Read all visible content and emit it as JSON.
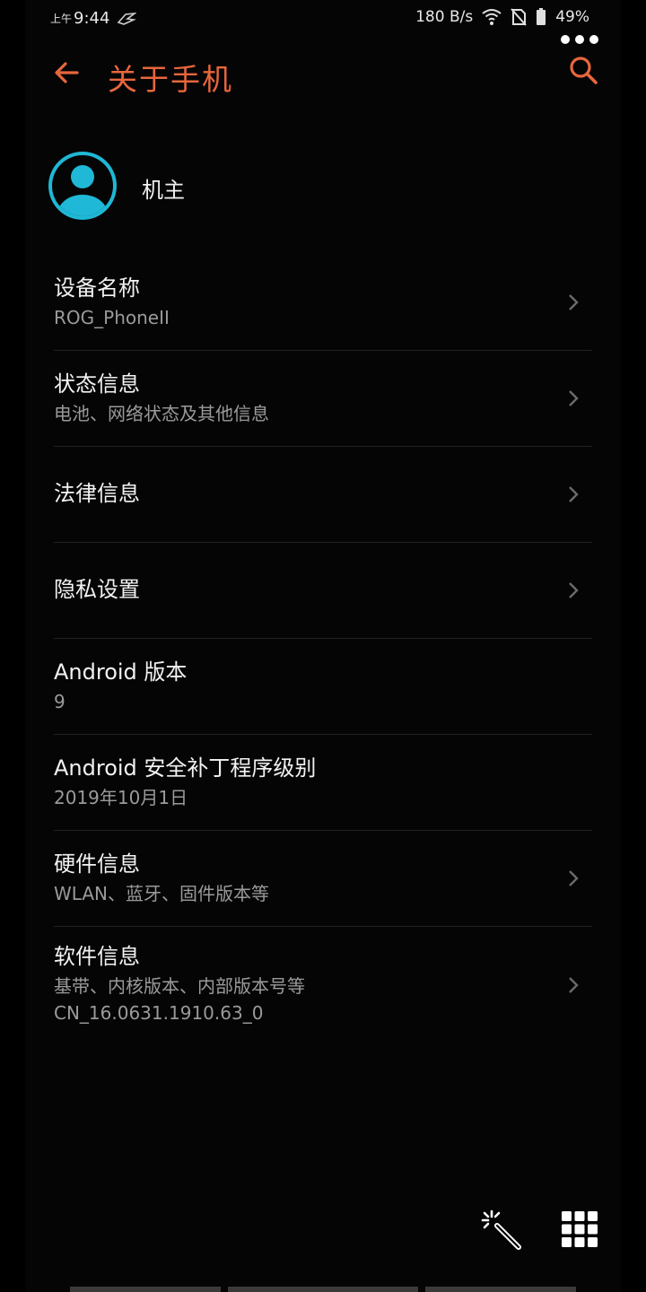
{
  "status_bar": {
    "ampm": "上午",
    "time": "9:44",
    "net_speed": "180 B/s",
    "battery": "49%"
  },
  "header": {
    "title": "关于手机"
  },
  "owner": {
    "name": "机主"
  },
  "items": [
    {
      "title": "设备名称",
      "subtitle": "ROG_PhoneII",
      "has_chevron": true
    },
    {
      "title": "状态信息",
      "subtitle": "电池、网络状态及其他信息",
      "has_chevron": true
    },
    {
      "title": "法律信息",
      "subtitle": "",
      "has_chevron": true
    },
    {
      "title": "隐私设置",
      "subtitle": "",
      "has_chevron": true
    },
    {
      "title": "Android 版本",
      "subtitle": "9",
      "has_chevron": false
    },
    {
      "title": "Android 安全补丁程序级别",
      "subtitle": "2019年10月1日",
      "has_chevron": false
    },
    {
      "title": "硬件信息",
      "subtitle": "WLAN、蓝牙、固件版本等",
      "has_chevron": true
    },
    {
      "title": "软件信息",
      "subtitle": "基带、内核版本、内部版本号等",
      "subtitle2": "CN_16.0631.1910.63_0",
      "has_chevron": true
    }
  ],
  "colors": {
    "accent": "#e8663c",
    "avatar": "#1fb8d6",
    "background": "#050506"
  },
  "icons": {
    "back": "arrow-left-icon",
    "search": "search-icon",
    "more": "more-dots-icon",
    "wand": "magic-wand-icon",
    "grid": "app-grid-icon"
  }
}
